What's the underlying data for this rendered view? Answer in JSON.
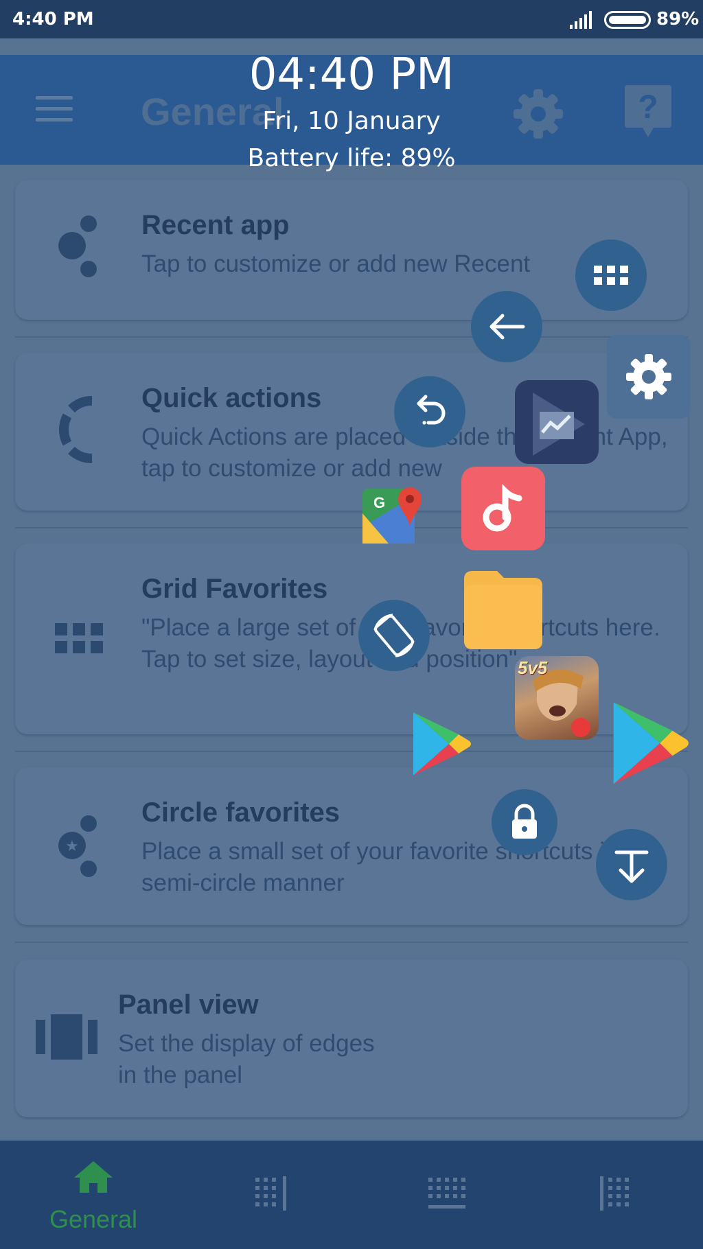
{
  "status_bar": {
    "time": "4:40 PM",
    "battery": "89%",
    "icons": [
      "signal-icon",
      "battery-icon"
    ]
  },
  "app_bar": {
    "title": "General",
    "icons": [
      "menu-icon",
      "settings-icon",
      "help-icon"
    ]
  },
  "overlay_clock": {
    "time": "04:40 PM",
    "date": "Fri, 10 January",
    "battery": "Battery life: 89%"
  },
  "cards": [
    {
      "title": "Recent app",
      "description": "Tap to customize or add new Recent",
      "icon": "recent-app-icon"
    },
    {
      "title": "Quick actions",
      "description": "Quick Actions are placed outside the Recent App, tap to customize or add new",
      "icon": "quick-actions-icon"
    },
    {
      "title": "Grid Favorites",
      "description": "\"Place a large set of your favorite shortcuts here. Tap to set size, layout and position\"",
      "icon": "grid-icon"
    },
    {
      "title": "Circle favorites",
      "description": "Place a small set of your favorite shortcuts in a semi-circle manner",
      "icon": "circle-favorites-icon"
    },
    {
      "title": "Panel view",
      "description": "Set the display of edges\n in the panel",
      "icon": "panel-icon"
    }
  ],
  "floating_items": [
    "apps-grid-icon",
    "back-arrow-icon",
    "settings-icon",
    "undo-icon",
    "stock-app-icon",
    "google-maps-icon",
    "music-app-icon",
    "files-app-icon",
    "rotate-screen-icon",
    "game-app-icon",
    "play-store-icon",
    "lock-icon",
    "download-icon"
  ],
  "game_badge": "5v5",
  "bottom_nav": {
    "items": [
      {
        "label": "General",
        "icon": "home-icon",
        "active": true
      },
      {
        "label": "",
        "icon": "grid-layout-icon-1",
        "active": false
      },
      {
        "label": "",
        "icon": "grid-layout-icon-2",
        "active": false
      },
      {
        "label": "",
        "icon": "grid-layout-icon-3",
        "active": false
      }
    ],
    "active_color": "#2f8f4f"
  },
  "colors": {
    "background": "#587292",
    "app_bar": "#2b5a92",
    "bottom_nav": "#23446f",
    "floating_button": "#31628f",
    "music_app": "#f2606a",
    "files_app": "#f7b84a"
  }
}
